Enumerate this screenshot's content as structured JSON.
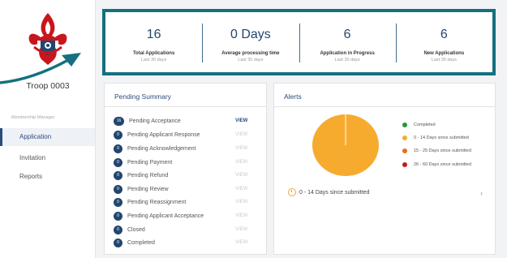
{
  "sidebar": {
    "unit_name": "Troop 0003",
    "section_label": "Membership Manager",
    "items": [
      {
        "label": "Application",
        "active": true
      },
      {
        "label": "Invitation",
        "active": false
      },
      {
        "label": "Reports",
        "active": false
      }
    ]
  },
  "stats": [
    {
      "value": "16",
      "label": "Total Applications",
      "sub": "Last 30 days"
    },
    {
      "value": "0 Days",
      "label": "Average processing time",
      "sub": "Last 30 days"
    },
    {
      "value": "6",
      "label": "Application in Progress",
      "sub": "Last 30 days"
    },
    {
      "value": "6",
      "label": "New Applications",
      "sub": "Last 30 days"
    }
  ],
  "pending": {
    "title": "Pending Summary",
    "rows": [
      {
        "count": "16",
        "label": "Pending Acceptance",
        "view": "VIEW",
        "active": true
      },
      {
        "count": "0",
        "label": "Pending Applicant Response",
        "view": "VIEW",
        "active": false
      },
      {
        "count": "0",
        "label": "Pending Acknowledgement",
        "view": "VIEW",
        "active": false
      },
      {
        "count": "0",
        "label": "Pending Payment",
        "view": "VIEW",
        "active": false
      },
      {
        "count": "0",
        "label": "Pending Refund",
        "view": "VIEW",
        "active": false
      },
      {
        "count": "0",
        "label": "Pending Review",
        "view": "VIEW",
        "active": false
      },
      {
        "count": "0",
        "label": "Pending Reassignment",
        "view": "VIEW",
        "active": false
      },
      {
        "count": "0",
        "label": "Pending Applicant Acceptance",
        "view": "VIEW",
        "active": false
      },
      {
        "count": "0",
        "label": "Closed",
        "view": "VIEW",
        "active": false
      },
      {
        "count": "0",
        "label": "Completed",
        "view": "VIEW",
        "active": false
      }
    ]
  },
  "alerts": {
    "title": "Alerts",
    "legend": [
      {
        "label": "Completed",
        "color": "#1e9a3c"
      },
      {
        "label": "0 - 14 Days since submitted",
        "color": "#f6ab2f"
      },
      {
        "label": "15 - 25 Days since submitted",
        "color": "#ec6a1f"
      },
      {
        "label": "26 - 60 Days since submitted",
        "color": "#c8161d"
      }
    ],
    "pie_color": "#f6ab2f",
    "footer": "0 - 14 Days since submitted"
  },
  "colors": {
    "accent": "#21466f",
    "highlight_border": "#14707e"
  }
}
